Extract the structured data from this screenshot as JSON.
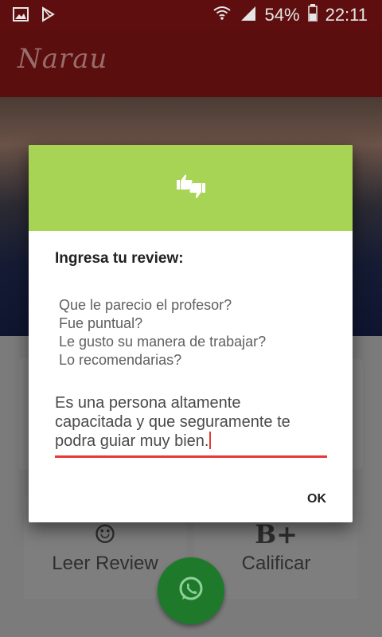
{
  "status_bar": {
    "battery": "54%",
    "time": "22:11"
  },
  "app_bar": {
    "logo": "Narau"
  },
  "tiles": {
    "read_review": {
      "icon": "smiley-icon",
      "label": "Leer Review"
    },
    "rate": {
      "icon_text": "B+",
      "label": "Calificar"
    }
  },
  "dialog": {
    "header_icon": "thumbs-up-down-icon",
    "title": "Ingresa tu review:",
    "questions": [
      "Que le parecio el profesor?",
      "Fue puntual?",
      "Le gusto su manera de trabajar?",
      "Lo recomendarias?"
    ],
    "review_lines": [
      "Es una persona altamente",
      "capacitada y que seguramente te",
      "podra guiar muy bien."
    ],
    "ok_label": "OK",
    "accent_color": "#a8d456",
    "field_underline_color": "#e53935"
  },
  "fab": {
    "icon": "whatsapp-icon",
    "color": "#1e7a2a"
  }
}
